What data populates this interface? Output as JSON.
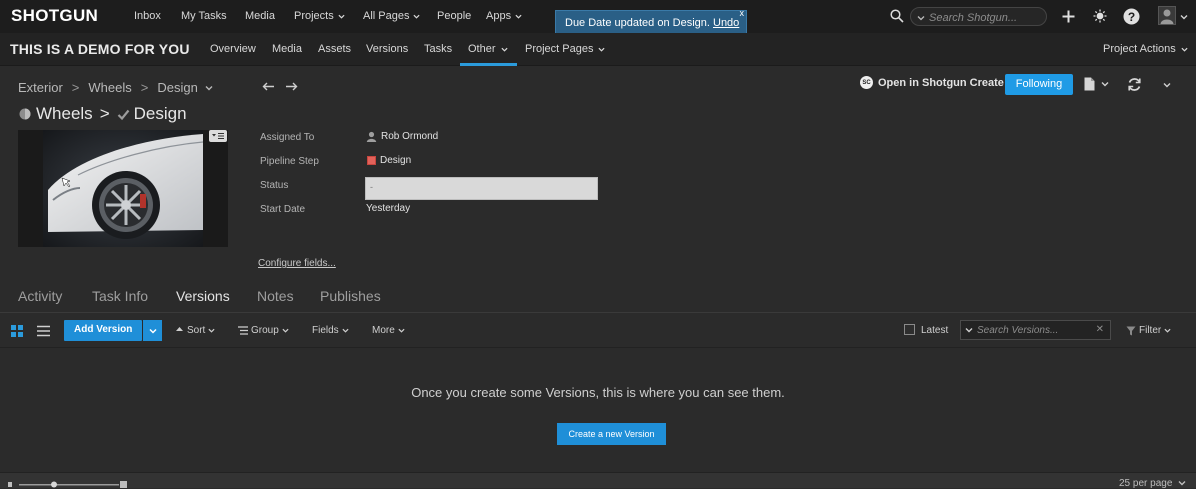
{
  "global_nav": {
    "logo": "SHOTGUN",
    "items": [
      "Inbox",
      "My Tasks",
      "Media",
      "Projects",
      "All Pages",
      "People",
      "Apps"
    ],
    "search_placeholder": "Search Shotgun..."
  },
  "toast": {
    "message": "Due Date updated on Design.",
    "undo": "Undo",
    "close": "x"
  },
  "project_nav": {
    "title": "THIS IS A DEMO FOR YOU",
    "items": [
      "Overview",
      "Media",
      "Assets",
      "Versions",
      "Tasks",
      "Other",
      "Project Pages"
    ],
    "active": "Other",
    "project_actions": "Project Actions"
  },
  "breadcrumb": {
    "items": [
      "Exterior",
      "Wheels",
      "Design"
    ],
    "separator": ">"
  },
  "entity": {
    "parent": "Wheels",
    "separator": ">",
    "name": "Design"
  },
  "header_actions": {
    "open_create": "Open in Shotgun Create",
    "sc_badge": "SC",
    "following": "Following"
  },
  "fields": {
    "assigned_to_label": "Assigned To",
    "assigned_to_value": "Rob Ormond",
    "pipeline_step_label": "Pipeline Step",
    "pipeline_step_value": "Design",
    "pipeline_step_color": "#e2625a",
    "status_label": "Status",
    "status_value": "-",
    "start_date_label": "Start Date",
    "start_date_value": "Yesterday",
    "configure": "Configure fields..."
  },
  "tabs": [
    "Activity",
    "Task Info",
    "Versions",
    "Notes",
    "Publishes"
  ],
  "active_tab": "Versions",
  "toolbar": {
    "add_version": "Add Version",
    "sort": "Sort",
    "group": "Group",
    "fields": "Fields",
    "more": "More",
    "latest": "Latest",
    "search_placeholder": "Search Versions...",
    "filter": "Filter"
  },
  "empty_state": {
    "message": "Once you create some Versions, this is where you can see them.",
    "button": "Create a new Version"
  },
  "footer": {
    "per_page": "25 per page"
  },
  "colors": {
    "accent": "#1f8fd8",
    "background": "#2b2b2b",
    "topbar": "#1d1d1d"
  }
}
